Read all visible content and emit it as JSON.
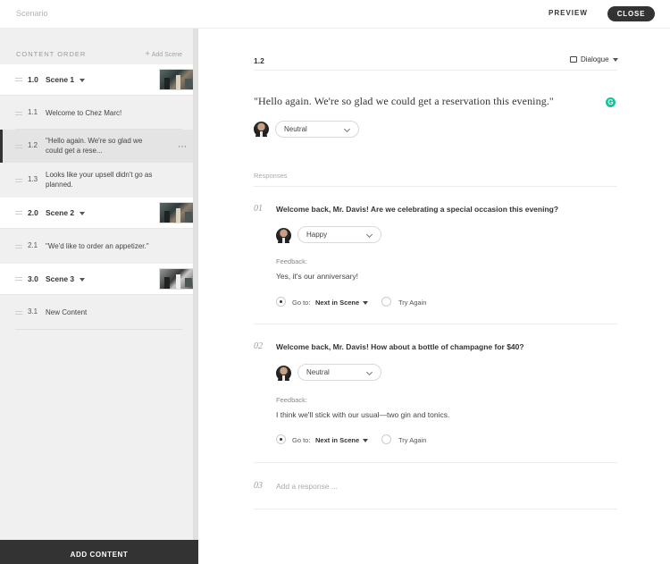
{
  "header": {
    "app_title": "Scenario",
    "preview_label": "PREVIEW",
    "close_label": "CLOSE"
  },
  "sidebar": {
    "section_title": "CONTENT ORDER",
    "add_scene_label": "Add Scene",
    "items": [
      {
        "type": "scene",
        "num": "1.0",
        "label": "Scene 1"
      },
      {
        "type": "item",
        "num": "1.1",
        "label": "Welcome to Chez Marc!"
      },
      {
        "type": "item",
        "num": "1.2",
        "label_line1": "\"Hello again. We're so glad we",
        "label_line2": "could get a rese...",
        "selected": true
      },
      {
        "type": "item",
        "num": "1.3",
        "label_line1": "Looks like your upsell didn't go as",
        "label_line2": "planned."
      },
      {
        "type": "scene",
        "num": "2.0",
        "label": "Scene 2"
      },
      {
        "type": "item",
        "num": "2.1",
        "label": "\"We'd like to order an appetizer.\""
      },
      {
        "type": "scene",
        "num": "3.0",
        "label": "Scene 3"
      },
      {
        "type": "item",
        "num": "3.1",
        "label": "New Content"
      }
    ],
    "add_content_label": "ADD CONTENT"
  },
  "main": {
    "item_code": "1.2",
    "type_select": "Dialogue",
    "prompt": "\"Hello again. We're so glad we could get a reservation this evening.\"",
    "prompt_emotion": "Neutral",
    "responses_label": "Responses",
    "responses": [
      {
        "num": "01",
        "text": "Welcome back, Mr. Davis! Are we celebrating a special occasion this evening?",
        "emotion": "Happy",
        "feedback_label": "Feedback:",
        "feedback": "Yes, it's our anniversary!",
        "goto_label": "Go to:",
        "goto_value": "Next in Scene",
        "try_again_label": "Try Again"
      },
      {
        "num": "02",
        "text": "Welcome back, Mr. Davis! How about a bottle of champagne for $40?",
        "emotion": "Neutral",
        "feedback_label": "Feedback:",
        "feedback": "I think we'll stick with our usual—two gin and tonics.",
        "goto_label": "Go to:",
        "goto_value": "Next in Scene",
        "try_again_label": "Try Again"
      }
    ],
    "add_response": {
      "num": "03",
      "placeholder": "Add a response ..."
    }
  },
  "colors": {
    "accent_dark": "#333333",
    "sidebar_bg": "#f0f0f0",
    "grammarly_green": "#15c39a"
  }
}
